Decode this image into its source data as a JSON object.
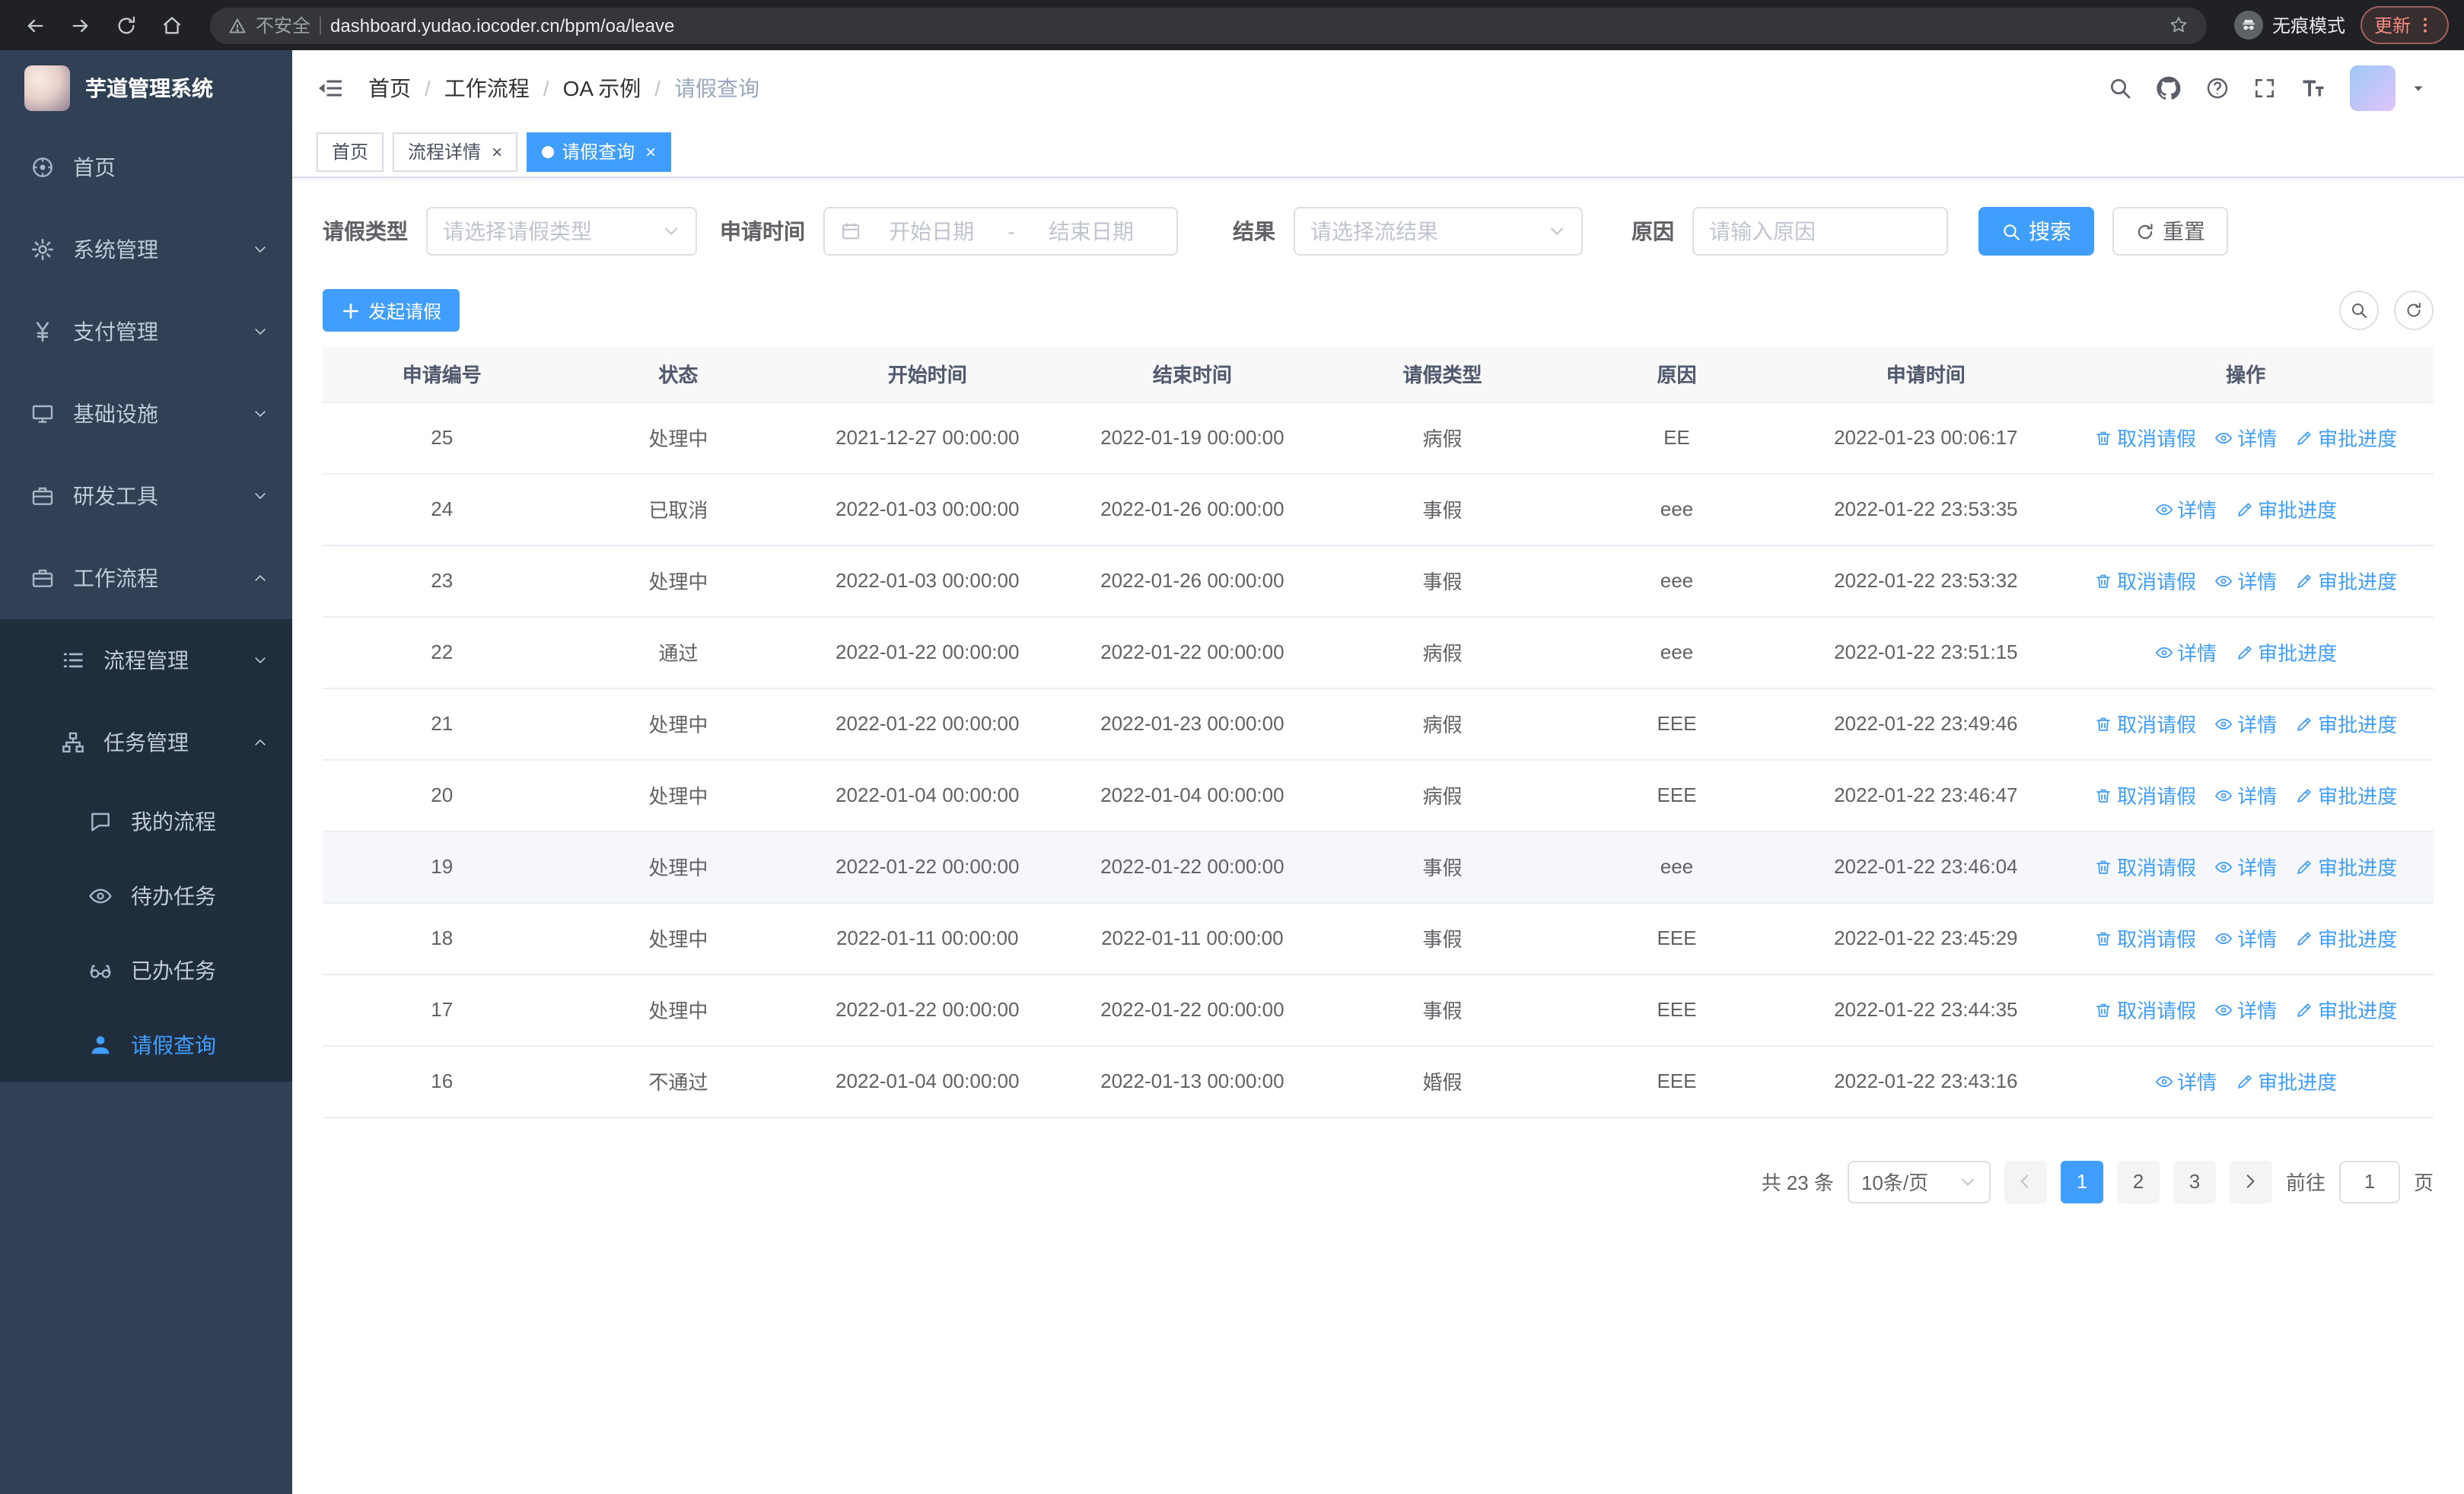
{
  "browser": {
    "security_label": "不安全",
    "url": "dashboard.yudao.iocoder.cn/bpm/oa/leave",
    "incognito_label": "无痕模式",
    "update_label": "更新"
  },
  "sidebar": {
    "logo_title": "芋道管理系统",
    "menu": [
      {
        "name": "home",
        "label": "首页",
        "icon": "dashboard",
        "level": 1
      },
      {
        "name": "system",
        "label": "系统管理",
        "icon": "gear",
        "level": 1,
        "arrow": "down"
      },
      {
        "name": "payment",
        "label": "支付管理",
        "icon": "yen",
        "level": 1,
        "arrow": "down"
      },
      {
        "name": "infrastructure",
        "label": "基础设施",
        "icon": "monitor",
        "level": 1,
        "arrow": "down"
      },
      {
        "name": "devtools",
        "label": "研发工具",
        "icon": "briefcase",
        "level": 1,
        "arrow": "down"
      },
      {
        "name": "workflow",
        "label": "工作流程",
        "icon": "briefcase",
        "level": 1,
        "arrow": "up"
      },
      {
        "name": "process-mgmt",
        "label": "流程管理",
        "icon": "list",
        "level": 2,
        "arrow": "down"
      },
      {
        "name": "task-mgmt",
        "label": "任务管理",
        "icon": "sitemap",
        "level": 2,
        "arrow": "up"
      },
      {
        "name": "my-process",
        "label": "我的流程",
        "icon": "chat",
        "level": 3
      },
      {
        "name": "todo-tasks",
        "label": "待办任务",
        "icon": "eye",
        "level": 3
      },
      {
        "name": "done-tasks",
        "label": "已办任务",
        "icon": "glasses",
        "level": 3
      },
      {
        "name": "leave-query",
        "label": "请假查询",
        "icon": "user",
        "level": 3,
        "active": true
      }
    ]
  },
  "navbar": {
    "breadcrumb": [
      "首页",
      "工作流程",
      "OA 示例",
      "请假查询"
    ]
  },
  "tabs": [
    {
      "label": "首页",
      "closable": false,
      "active": false
    },
    {
      "label": "流程详情",
      "closable": true,
      "active": false
    },
    {
      "label": "请假查询",
      "closable": true,
      "active": true
    }
  ],
  "filters": {
    "leave_type_label": "请假类型",
    "leave_type_placeholder": "请选择请假类型",
    "apply_time_label": "申请时间",
    "start_date_placeholder": "开始日期",
    "range_separator": "-",
    "end_date_placeholder": "结束日期",
    "result_label": "结果",
    "result_placeholder": "请选择流结果",
    "reason_label": "原因",
    "reason_placeholder": "请输入原因",
    "search_label": "搜索",
    "reset_label": "重置"
  },
  "toolbar": {
    "create_label": "发起请假"
  },
  "table": {
    "columns": [
      "申请编号",
      "状态",
      "开始时间",
      "结束时间",
      "请假类型",
      "原因",
      "申请时间",
      "操作"
    ],
    "col_widths": [
      "11.3%",
      "11.1%",
      "12.5%",
      "12.6%",
      "11.1%",
      "11.1%",
      "12.5%",
      "17.8%"
    ],
    "action_defs": {
      "cancel": {
        "label": "取消请假",
        "icon": "trash"
      },
      "detail": {
        "label": "详情",
        "icon": "eye"
      },
      "progress": {
        "label": "审批进度",
        "icon": "edit"
      }
    },
    "rows": [
      {
        "id": "25",
        "status": "处理中",
        "start": "2021-12-27 00:00:00",
        "end": "2022-01-19 00:00:00",
        "type": "病假",
        "reason": "EE",
        "applied": "2022-01-23 00:06:17",
        "actions": [
          "cancel",
          "detail",
          "progress"
        ]
      },
      {
        "id": "24",
        "status": "已取消",
        "start": "2022-01-03 00:00:00",
        "end": "2022-01-26 00:00:00",
        "type": "事假",
        "reason": "eee",
        "applied": "2022-01-22 23:53:35",
        "actions": [
          "detail",
          "progress"
        ]
      },
      {
        "id": "23",
        "status": "处理中",
        "start": "2022-01-03 00:00:00",
        "end": "2022-01-26 00:00:00",
        "type": "事假",
        "reason": "eee",
        "applied": "2022-01-22 23:53:32",
        "actions": [
          "cancel",
          "detail",
          "progress"
        ]
      },
      {
        "id": "22",
        "status": "通过",
        "start": "2022-01-22 00:00:00",
        "end": "2022-01-22 00:00:00",
        "type": "病假",
        "reason": "eee",
        "applied": "2022-01-22 23:51:15",
        "actions": [
          "detail",
          "progress"
        ]
      },
      {
        "id": "21",
        "status": "处理中",
        "start": "2022-01-22 00:00:00",
        "end": "2022-01-23 00:00:00",
        "type": "病假",
        "reason": "EEE",
        "applied": "2022-01-22 23:49:46",
        "actions": [
          "cancel",
          "detail",
          "progress"
        ]
      },
      {
        "id": "20",
        "status": "处理中",
        "start": "2022-01-04 00:00:00",
        "end": "2022-01-04 00:00:00",
        "type": "病假",
        "reason": "EEE",
        "applied": "2022-01-22 23:46:47",
        "actions": [
          "cancel",
          "detail",
          "progress"
        ]
      },
      {
        "id": "19",
        "status": "处理中",
        "start": "2022-01-22 00:00:00",
        "end": "2022-01-22 00:00:00",
        "type": "事假",
        "reason": "eee",
        "applied": "2022-01-22 23:46:04",
        "actions": [
          "cancel",
          "detail",
          "progress"
        ],
        "highlight": true
      },
      {
        "id": "18",
        "status": "处理中",
        "start": "2022-01-11 00:00:00",
        "end": "2022-01-11 00:00:00",
        "type": "事假",
        "reason": "EEE",
        "applied": "2022-01-22 23:45:29",
        "actions": [
          "cancel",
          "detail",
          "progress"
        ]
      },
      {
        "id": "17",
        "status": "处理中",
        "start": "2022-01-22 00:00:00",
        "end": "2022-01-22 00:00:00",
        "type": "事假",
        "reason": "EEE",
        "applied": "2022-01-22 23:44:35",
        "actions": [
          "cancel",
          "detail",
          "progress"
        ]
      },
      {
        "id": "16",
        "status": "不通过",
        "start": "2022-01-04 00:00:00",
        "end": "2022-01-13 00:00:00",
        "type": "婚假",
        "reason": "EEE",
        "applied": "2022-01-22 23:43:16",
        "actions": [
          "detail",
          "progress"
        ]
      }
    ]
  },
  "pagination": {
    "total_text": "共 23 条",
    "page_size": "10条/页",
    "pages": [
      "1",
      "2",
      "3"
    ],
    "active_page": "1",
    "goto_label": "前往",
    "goto_value": "1",
    "page_unit": "页"
  },
  "colors": {
    "primary": "#409eff",
    "sidebar_bg": "#304156",
    "sidebar_sub_bg": "#1f2d3d",
    "chrome_bg": "#202124",
    "update_red": "#f28b82"
  }
}
